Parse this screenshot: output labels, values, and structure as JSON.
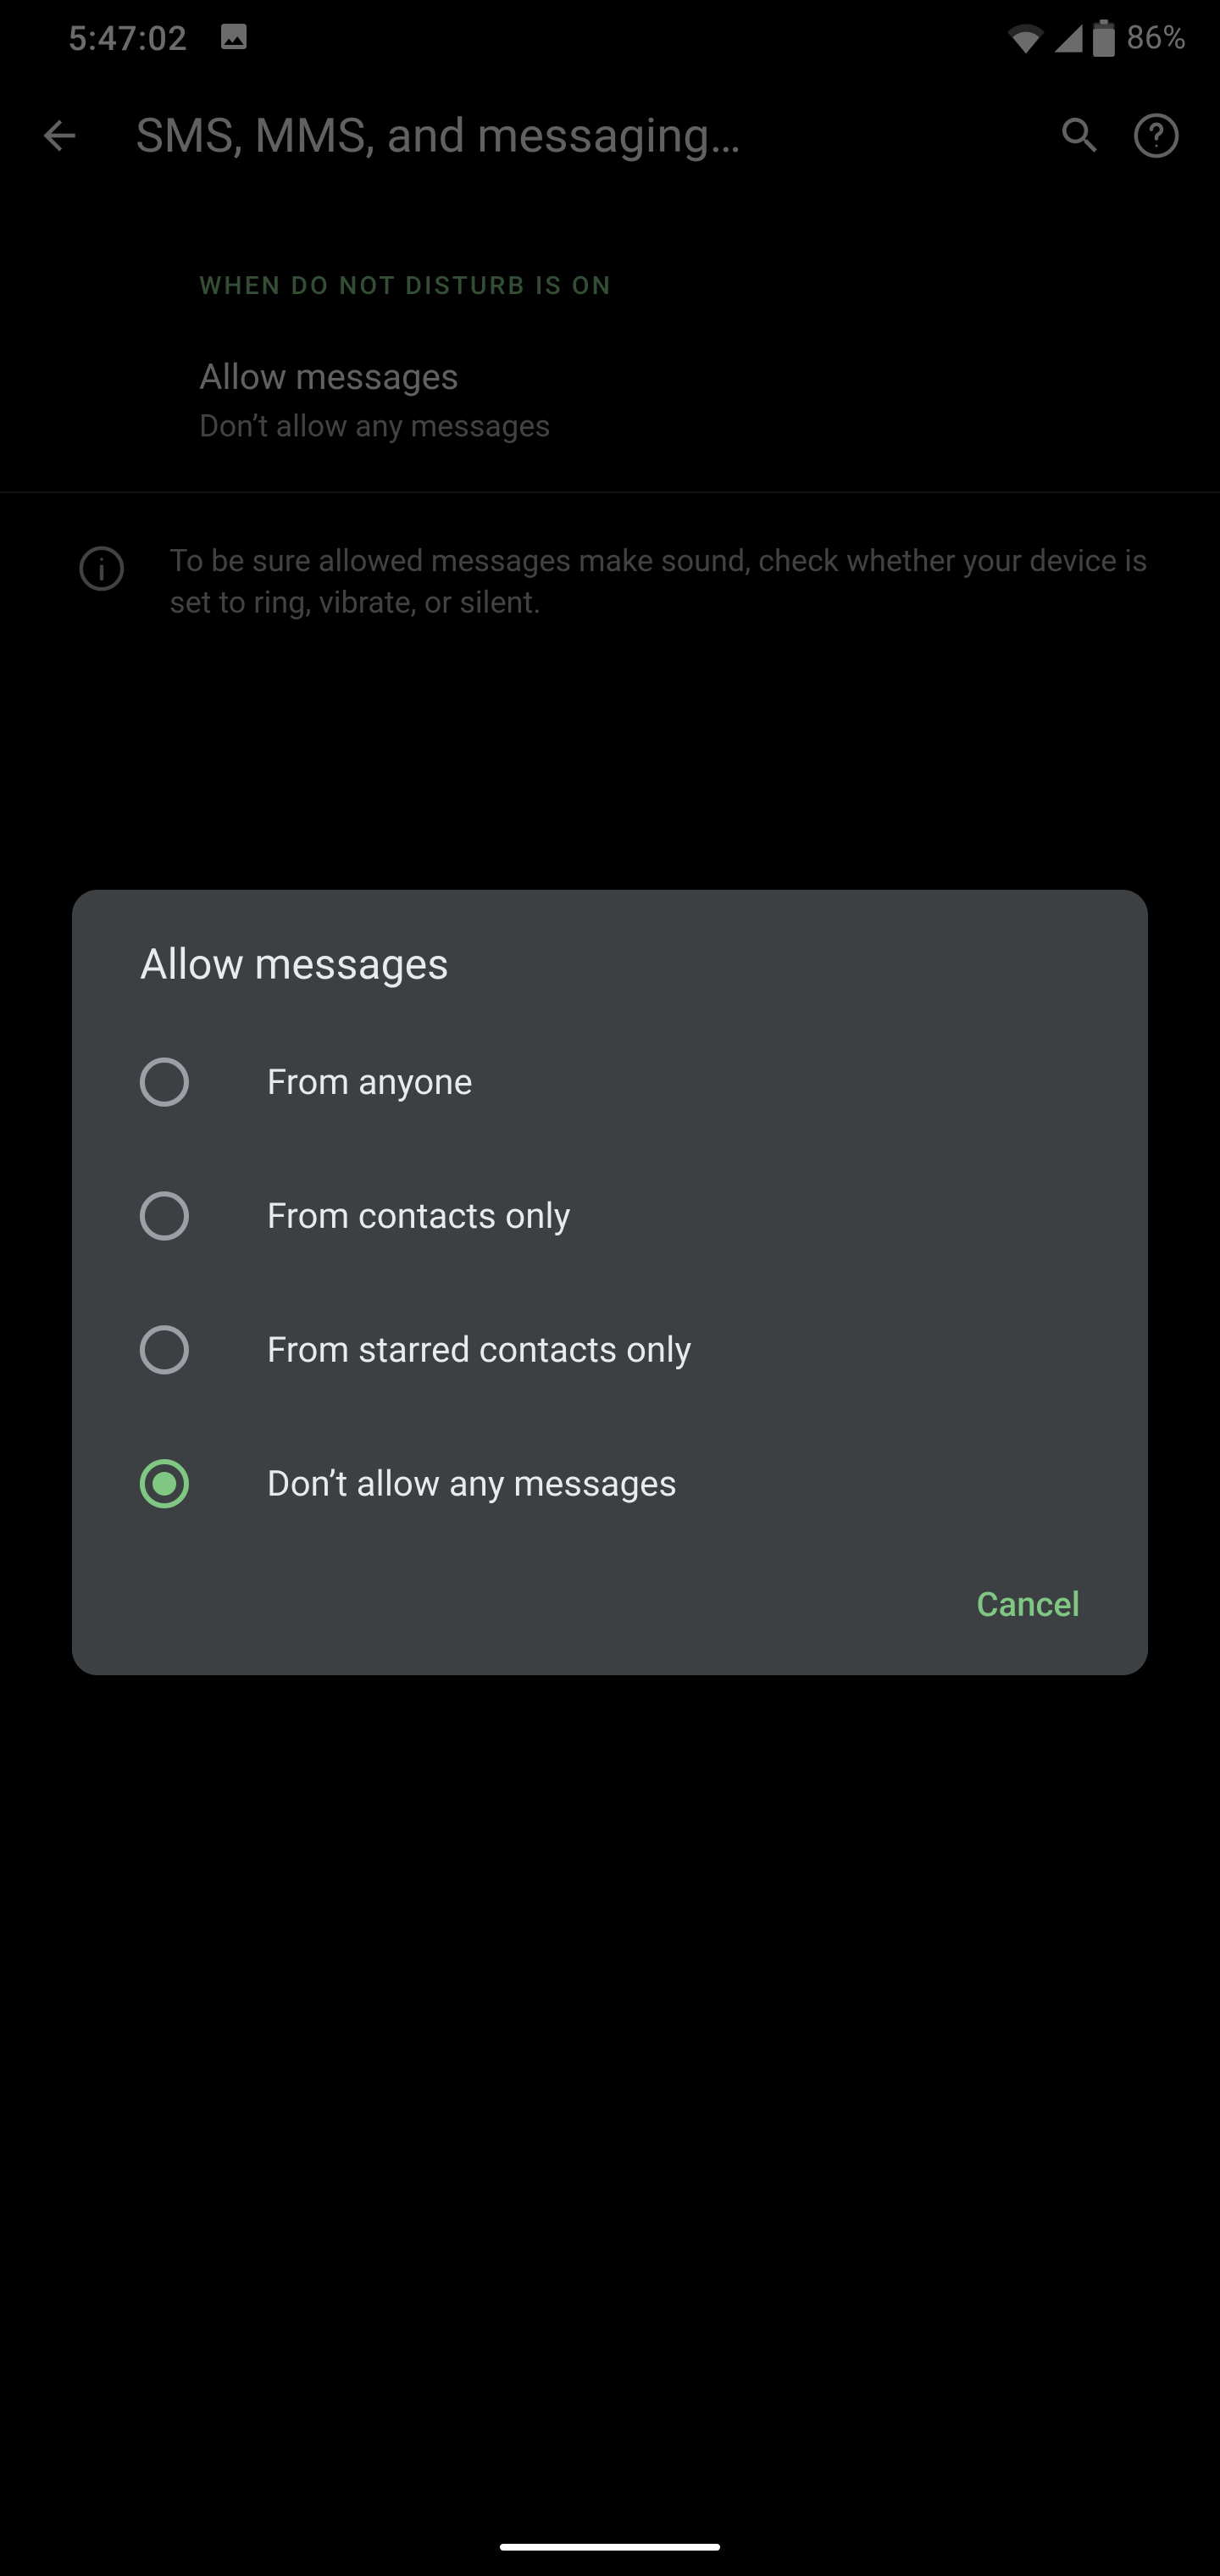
{
  "status": {
    "time": "5:47:02",
    "battery_pct": "86%"
  },
  "appbar": {
    "title": "SMS, MMS, and messaging…"
  },
  "section": {
    "header": "WHEN DO NOT DISTURB IS ON",
    "pref_title": "Allow messages",
    "pref_summary": "Don’t allow any messages"
  },
  "info": {
    "text": "To be sure allowed messages make sound, check whether your device is set to ring, vibrate, or silent."
  },
  "dialog": {
    "title": "Allow messages",
    "options": [
      "From anyone",
      "From contacts only",
      "From starred contacts only",
      "Don’t allow any messages"
    ],
    "selected_index": 3,
    "cancel": "Cancel"
  }
}
